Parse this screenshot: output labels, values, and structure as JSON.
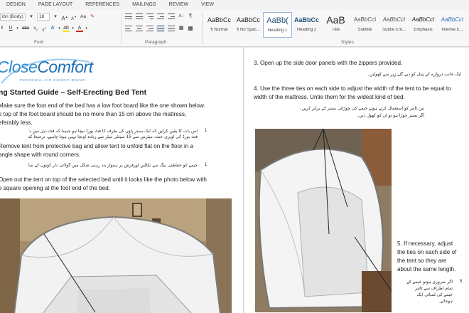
{
  "ribbon": {
    "tabs": [
      "DESIGN",
      "PAGE LAYOUT",
      "REFERENCES",
      "MAILINGS",
      "REVIEW",
      "VIEW"
    ],
    "font_name": "ibri (Body)",
    "font_size": "18",
    "group_font": "Font",
    "group_paragraph": "Paragraph",
    "group_styles": "Styles",
    "styles": [
      {
        "preview": "AaBbCc",
        "name": "¶ Normal"
      },
      {
        "preview": "AaBbCc",
        "name": "¶ No Spac..."
      },
      {
        "preview": "AaBb(",
        "name": "Heading 1"
      },
      {
        "preview": "AaBbCc",
        "name": "Heading 2"
      },
      {
        "preview": "AaB",
        "name": "Title"
      },
      {
        "preview": "AaBbCcI",
        "name": "Subtitle"
      },
      {
        "preview": "AaBbCcI",
        "name": "Subtle Em..."
      },
      {
        "preview": "AaBbCcI",
        "name": "Emphasis"
      },
      {
        "preview": "AaBbCcI",
        "name": "Intense E..."
      }
    ]
  },
  "doc": {
    "logo_close": "Close",
    "logo_comfort": "Comfort",
    "logo_sub": "PERSONAL AIR CONDITIONING",
    "title": "ng Started Guide – Self-Erecting Bed Tent",
    "p1a": "Make sure the foot end of the bed has a low foot board like the one shown below.",
    "p1b": "e top of the foot board should be no more than 15 cm above the mattress,",
    "p1c": "eferably less.",
    "u1a": "اس بات کا یقین کرلیں کہ ایک بستر پاؤں کی طرف کا فٹ بورڈ نیچا ہو جیسا کہ فٹ ذیل میں دکھایا گیا ہے۔",
    "u1b": "فٹ بورڈ کی اوپری حصہ میٹرس سے 15 سینٹی میٹر سے زیادہ اونچا نہیں ہونا چاہیے، ترجیحاً کم ہونا چاہیے۔",
    "n1": "1",
    "p2a": "Remove tent from protective bag and allow tent to unfold flat on the floor in a",
    "p2b": "angle shape with round corners.",
    "u2": "خیمے کو حفاظتی بیگ سے نکالیں اورفرش پر ہموار بند رہنی شکل میں گولائی دار کونوں کے ساتھ کھلنے دیں۔",
    "n2": "1",
    "p3a": "Open out the tent on top of the selected bed until it looks like the photo below with",
    "p3b": "e square opening at the foot end of the bed.",
    "p4": "3.  Open up the side door panels with the zippers provided.",
    "u4": "ایک جانب دروازے کے پینل کو دیے گئے زِپر سے کھولیں۔",
    "p5a": "4.  Use the three ties on each side to adjust the width of the tent to be equal to",
    "p5b": "width of the mattress. Untie them for the widest kind of bed.",
    "u5a": "تین ٹائیز کو استعمال کرتے ہوئے خیمے کی چوڑائی بستر کے برابر کریں۔",
    "u5b": "اگر بستر چوڑا ہو تو ان کو کھول دیں۔",
    "p6a": "5. If necessary, adjust",
    "p6b": "the ties on each side of",
    "p6c": "the tent so they are",
    "p6d": "about the same length.",
    "u6a": "اگر ضروری ہوتو خیمے کے",
    "u6b": "تمام اطراف سے ٹائیز",
    "u6c": "خیمے کی لمبائی ایک",
    "u6d": "ہوجائے۔",
    "n6": "5"
  }
}
